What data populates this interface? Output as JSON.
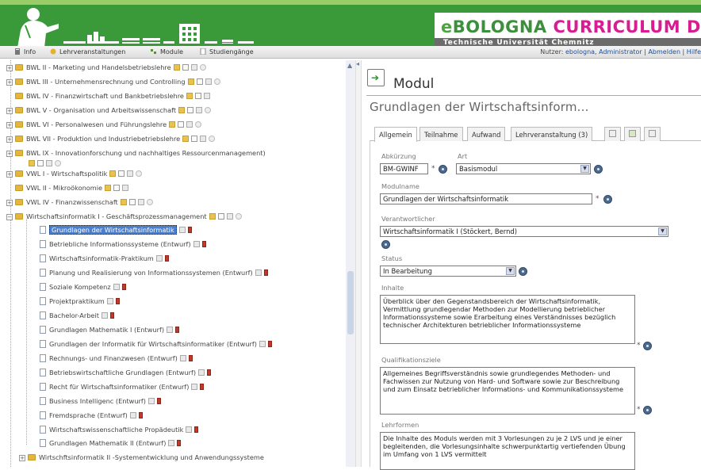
{
  "header": {
    "logo_e": "e",
    "logo_bologna": "BOLOGNA",
    "logo_curriculum": "CURRICULUM DESIGNER",
    "subtitle": "Technische Universität Chemnitz"
  },
  "menubar": {
    "items": [
      {
        "label": "Info",
        "icon": "info-icon"
      },
      {
        "label": "Lehrveranstaltungen",
        "icon": "lehrveranstaltungen-icon"
      },
      {
        "label": "Module",
        "icon": "module-icon"
      },
      {
        "label": "Studiengänge",
        "icon": "studiengaenge-icon"
      }
    ],
    "user_prefix": "Nutzer: ",
    "user_name": "ebologna, Administrator",
    "separator": " | ",
    "logout": "Abmelden",
    "help": "Hilfe"
  },
  "tree": {
    "top": [
      {
        "label": "BWL II - Marketing und Handelsbetriebslehre"
      },
      {
        "label": "BWL III - Unternehmensrechnung und Controlling"
      },
      {
        "label": "BWL IV - Finanzwirtschaft und Bankbetriebslehre"
      },
      {
        "label": "BWL V - Organisation und Arbeitswissenschaft"
      },
      {
        "label": "BWL VI - Personalwesen und Führungslehre"
      },
      {
        "label": "BWL VII - Produktion und Industriebetriebslehre"
      },
      {
        "label": "BWL IX - Innovationforschung und nachhaltiges Ressourcenmanagement)"
      },
      {
        "label": "VWL I - Wirtschaftspolitik"
      },
      {
        "label": "VWL II - Mikroökonomie"
      },
      {
        "label": "VWL IV - Finanzwissenschaft"
      },
      {
        "label": "Wirtschaftsinformatik I - Geschäftsprozessmanagement"
      }
    ],
    "children": [
      {
        "label": "Grundlagen der Wirtschaftsinformatik",
        "selected": true
      },
      {
        "label": "Betriebliche Informationssysteme (Entwurf)"
      },
      {
        "label": "Wirtschaftsinformatik-Praktikum"
      },
      {
        "label": "Planung und Realisierung von Informationssystemen (Entwurf)"
      },
      {
        "label": "Soziale Kompetenz"
      },
      {
        "label": "Projektpraktikum"
      },
      {
        "label": "Bachelor-Arbeit"
      },
      {
        "label": "Grundlagen Mathematik I (Entwurf)"
      },
      {
        "label": "Grundlagen der Informatik für Wirtschaftsinformatiker (Entwurf)"
      },
      {
        "label": "Rechnungs- und Finanzwesen (Entwurf)"
      },
      {
        "label": "Betriebswirtschaftliche Grundlagen (Entwurf)"
      },
      {
        "label": "Recht für Wirtschaftsinformatiker (Entwurf)"
      },
      {
        "label": "Business Intelligenc (Entwurf)"
      },
      {
        "label": "Fremdsprache (Entwurf)"
      },
      {
        "label": "Wirtschaftswissenschaftliche Propädeutik"
      },
      {
        "label": "Grundlagen Mathematik II (Entwurf)"
      }
    ],
    "bottom": {
      "label": "Wirtschftsinformatik II -Systementwicklung und Anwendungssysteme"
    }
  },
  "panel": {
    "heading": "Modul",
    "module_name_short": "Grundlagen der Wirtschaftsinform...",
    "tabs": [
      {
        "label": "Allgemein",
        "active": true
      },
      {
        "label": "Teilnahme"
      },
      {
        "label": "Aufwand"
      },
      {
        "label": "Lehrveranstaltung (3)"
      }
    ],
    "fields": {
      "abkuerzung_label": "Abkürzung",
      "abkuerzung_value": "BM-GWINF",
      "art_label": "Art",
      "art_value": "Basismodul",
      "modulname_label": "Modulname",
      "modulname_value": "Grundlagen der Wirtschaftsinformatik",
      "verantwortlicher_label": "Verantwortlicher",
      "verantwortlicher_value": "Wirtschaftsinformatik I (Stöckert, Bernd)",
      "status_label": "Status",
      "status_value": "In Bearbeitung",
      "inhalte_label": "Inhalte",
      "inhalte_value": "Überblick über den Gegenstandsbereich der Wirtschaftsinformatik, Vermittlung grundlegendar Methoden zur Modellierung betrieblicher Informationssysteme sowie Erarbeitung eines Verständnisses bezüglich technischer Architekturen betrieblicher Informationssysteme",
      "quali_label": "Qualifikationsziele",
      "quali_value": "Allgemeines Begriffsverständnis sowie grundlegendes Methoden- und Fachwissen zur Nutzung von Hard- und Software sowie zur Beschreibung und zum Einsatz betrieblicher Informations- und Kommunikationssysteme",
      "lehrformen_label": "Lehrformen",
      "lehrformen_value": "Die Inhalte des Moduls werden mit 3 Vorlesungen zu je 2 LVS und je einer begleitenden, die Vorlesungsinhalte schwerpunktartig vertiefenden Übung im Umfang von 1 LVS vermittelt",
      "required_mark": "*"
    }
  },
  "colors": {
    "header_green": "#3a9a3a",
    "brand_magenta": "#d81d92",
    "selection_blue": "#4a7fd1"
  }
}
